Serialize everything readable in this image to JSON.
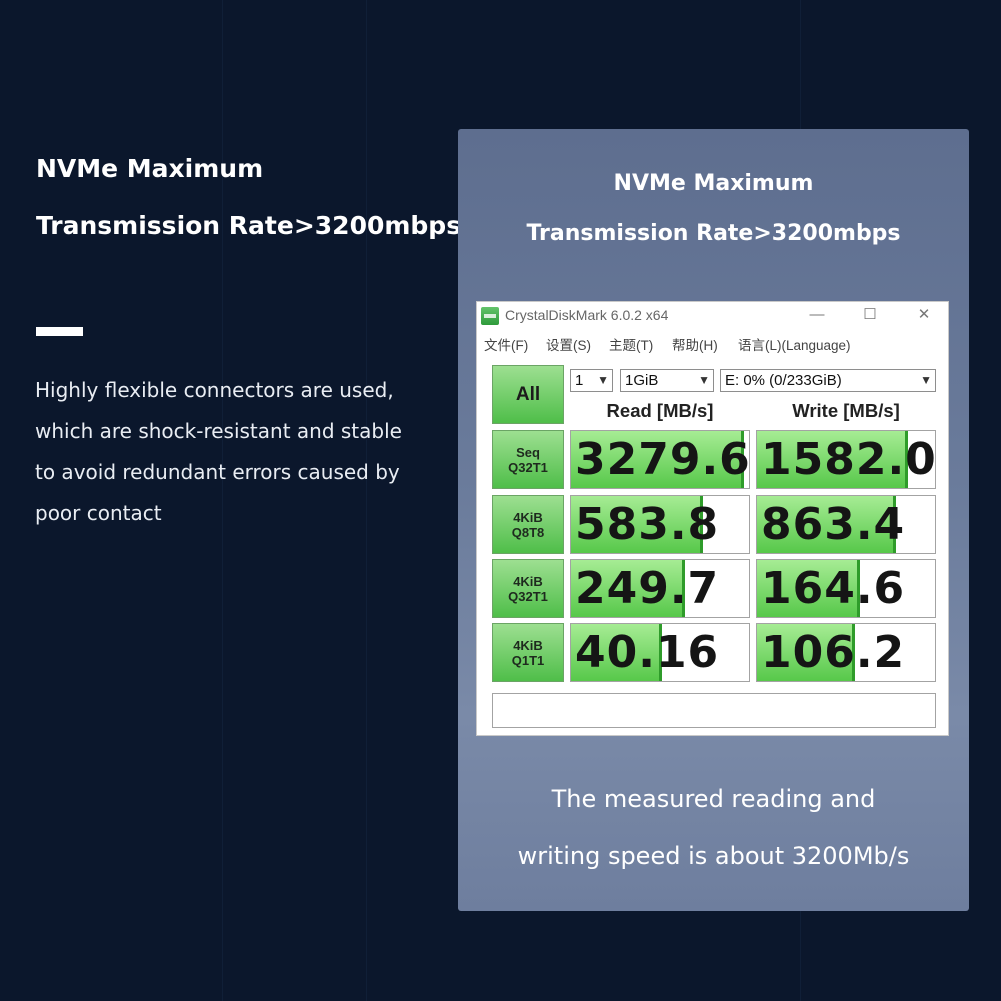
{
  "left": {
    "heading_line1": "NVMe Maximum",
    "heading_line2": "Transmission Rate>3200mbps",
    "body_lines": [
      "Highly flexible connectors are used,",
      "which are shock-resistant and stable",
      "to avoid redundant errors caused by",
      "poor contact"
    ]
  },
  "panel": {
    "heading_line1": "NVMe Maximum",
    "heading_line2": "Transmission Rate>3200mbps",
    "caption_line1": "The measured reading and",
    "caption_line2": "writing speed is about 3200Mb/s"
  },
  "app": {
    "title": "CrystalDiskMark 6.0.2 x64",
    "window_controls": {
      "minimize": "—",
      "maximize": "☐",
      "close": "✕"
    },
    "menu": [
      "文件(F)",
      "设置(S)",
      "主题(T)",
      "帮助(H)",
      "语言(L)(Language)"
    ],
    "all_button": "All",
    "count_select": "1",
    "size_select": "1GiB",
    "drive_select": "E: 0% (0/233GiB)",
    "read_header": "Read [MB/s]",
    "write_header": "Write [MB/s]",
    "accent_color": "#57c84a",
    "tests": [
      {
        "line1": "Seq",
        "line2": "Q32T1",
        "read": "3279.6",
        "write": "1582.0",
        "read_fill": 0.97,
        "write_fill": 0.85
      },
      {
        "line1": "4KiB",
        "line2": "Q8T8",
        "read": "583.8",
        "write": "863.4",
        "read_fill": 0.74,
        "write_fill": 0.78
      },
      {
        "line1": "4KiB",
        "line2": "Q32T1",
        "read": "249.7",
        "write": "164.6",
        "read_fill": 0.64,
        "write_fill": 0.58
      },
      {
        "line1": "4KiB",
        "line2": "Q1T1",
        "read": "40.16",
        "write": "106.2",
        "read_fill": 0.51,
        "write_fill": 0.55
      }
    ]
  }
}
